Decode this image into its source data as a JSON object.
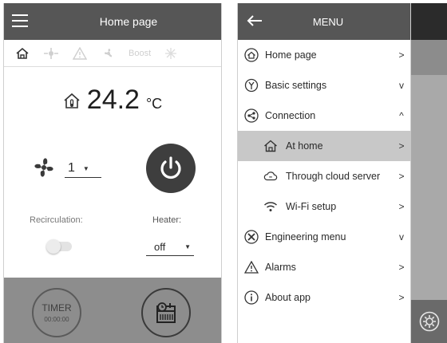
{
  "home": {
    "title": "Home page",
    "status": {
      "boost_label": "Boost"
    },
    "temperature": {
      "value": "24.2",
      "unit": "°C"
    },
    "fan": {
      "speed": "1"
    },
    "recirculation": {
      "label": "Recirculation:",
      "enabled": false
    },
    "heater": {
      "label": "Heater:",
      "value": "off"
    },
    "timer": {
      "label": "TIMER",
      "time": "00:00:00"
    }
  },
  "menu": {
    "title": "MENU",
    "items": [
      {
        "label": "Home page",
        "icon": "home-icon",
        "chevron": ">"
      },
      {
        "label": "Basic settings",
        "icon": "settings-icon",
        "chevron": "v"
      },
      {
        "label": "Connection",
        "icon": "connection-icon",
        "chevron": "^"
      },
      {
        "label": "At home",
        "icon": "house-icon",
        "chevron": ">"
      },
      {
        "label": "Through cloud server",
        "icon": "cloud-icon",
        "chevron": ">"
      },
      {
        "label": "Wi-Fi setup",
        "icon": "wifi-icon",
        "chevron": ">"
      },
      {
        "label": "Engineering menu",
        "icon": "tools-icon",
        "chevron": "v"
      },
      {
        "label": "Alarms",
        "icon": "alarm-icon",
        "chevron": ">"
      },
      {
        "label": "About app",
        "icon": "info-icon",
        "chevron": ">"
      }
    ]
  },
  "colors": {
    "header": "#565656",
    "bottom_bar": "#8d8d8d",
    "active_item": "#c8c8c8",
    "power_button": "#3e3e3e"
  }
}
